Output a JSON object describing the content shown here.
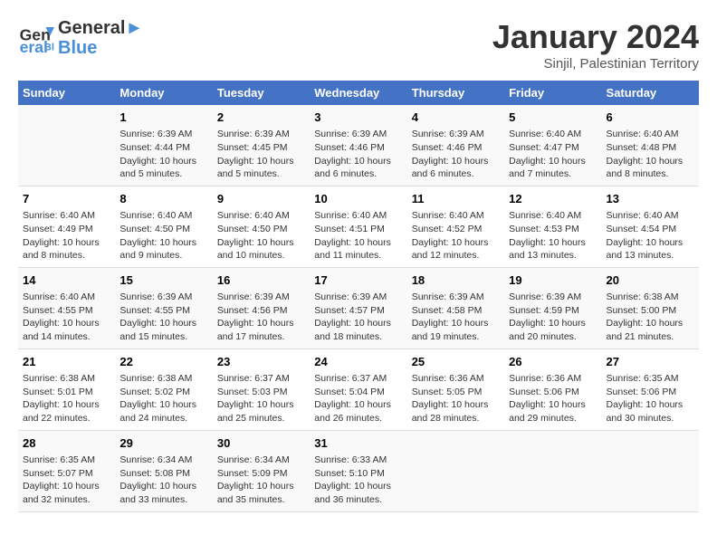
{
  "logo": {
    "line1": "General",
    "line2": "Blue"
  },
  "title": "January 2024",
  "subtitle": "Sinjil, Palestinian Territory",
  "days_header": [
    "Sunday",
    "Monday",
    "Tuesday",
    "Wednesday",
    "Thursday",
    "Friday",
    "Saturday"
  ],
  "weeks": [
    [
      {
        "num": "",
        "text": ""
      },
      {
        "num": "1",
        "text": "Sunrise: 6:39 AM\nSunset: 4:44 PM\nDaylight: 10 hours\nand 5 minutes."
      },
      {
        "num": "2",
        "text": "Sunrise: 6:39 AM\nSunset: 4:45 PM\nDaylight: 10 hours\nand 5 minutes."
      },
      {
        "num": "3",
        "text": "Sunrise: 6:39 AM\nSunset: 4:46 PM\nDaylight: 10 hours\nand 6 minutes."
      },
      {
        "num": "4",
        "text": "Sunrise: 6:39 AM\nSunset: 4:46 PM\nDaylight: 10 hours\nand 6 minutes."
      },
      {
        "num": "5",
        "text": "Sunrise: 6:40 AM\nSunset: 4:47 PM\nDaylight: 10 hours\nand 7 minutes."
      },
      {
        "num": "6",
        "text": "Sunrise: 6:40 AM\nSunset: 4:48 PM\nDaylight: 10 hours\nand 8 minutes."
      }
    ],
    [
      {
        "num": "7",
        "text": "Sunrise: 6:40 AM\nSunset: 4:49 PM\nDaylight: 10 hours\nand 8 minutes."
      },
      {
        "num": "8",
        "text": "Sunrise: 6:40 AM\nSunset: 4:50 PM\nDaylight: 10 hours\nand 9 minutes."
      },
      {
        "num": "9",
        "text": "Sunrise: 6:40 AM\nSunset: 4:50 PM\nDaylight: 10 hours\nand 10 minutes."
      },
      {
        "num": "10",
        "text": "Sunrise: 6:40 AM\nSunset: 4:51 PM\nDaylight: 10 hours\nand 11 minutes."
      },
      {
        "num": "11",
        "text": "Sunrise: 6:40 AM\nSunset: 4:52 PM\nDaylight: 10 hours\nand 12 minutes."
      },
      {
        "num": "12",
        "text": "Sunrise: 6:40 AM\nSunset: 4:53 PM\nDaylight: 10 hours\nand 13 minutes."
      },
      {
        "num": "13",
        "text": "Sunrise: 6:40 AM\nSunset: 4:54 PM\nDaylight: 10 hours\nand 13 minutes."
      }
    ],
    [
      {
        "num": "14",
        "text": "Sunrise: 6:40 AM\nSunset: 4:55 PM\nDaylight: 10 hours\nand 14 minutes."
      },
      {
        "num": "15",
        "text": "Sunrise: 6:39 AM\nSunset: 4:55 PM\nDaylight: 10 hours\nand 15 minutes."
      },
      {
        "num": "16",
        "text": "Sunrise: 6:39 AM\nSunset: 4:56 PM\nDaylight: 10 hours\nand 17 minutes."
      },
      {
        "num": "17",
        "text": "Sunrise: 6:39 AM\nSunset: 4:57 PM\nDaylight: 10 hours\nand 18 minutes."
      },
      {
        "num": "18",
        "text": "Sunrise: 6:39 AM\nSunset: 4:58 PM\nDaylight: 10 hours\nand 19 minutes."
      },
      {
        "num": "19",
        "text": "Sunrise: 6:39 AM\nSunset: 4:59 PM\nDaylight: 10 hours\nand 20 minutes."
      },
      {
        "num": "20",
        "text": "Sunrise: 6:38 AM\nSunset: 5:00 PM\nDaylight: 10 hours\nand 21 minutes."
      }
    ],
    [
      {
        "num": "21",
        "text": "Sunrise: 6:38 AM\nSunset: 5:01 PM\nDaylight: 10 hours\nand 22 minutes."
      },
      {
        "num": "22",
        "text": "Sunrise: 6:38 AM\nSunset: 5:02 PM\nDaylight: 10 hours\nand 24 minutes."
      },
      {
        "num": "23",
        "text": "Sunrise: 6:37 AM\nSunset: 5:03 PM\nDaylight: 10 hours\nand 25 minutes."
      },
      {
        "num": "24",
        "text": "Sunrise: 6:37 AM\nSunset: 5:04 PM\nDaylight: 10 hours\nand 26 minutes."
      },
      {
        "num": "25",
        "text": "Sunrise: 6:36 AM\nSunset: 5:05 PM\nDaylight: 10 hours\nand 28 minutes."
      },
      {
        "num": "26",
        "text": "Sunrise: 6:36 AM\nSunset: 5:06 PM\nDaylight: 10 hours\nand 29 minutes."
      },
      {
        "num": "27",
        "text": "Sunrise: 6:35 AM\nSunset: 5:06 PM\nDaylight: 10 hours\nand 30 minutes."
      }
    ],
    [
      {
        "num": "28",
        "text": "Sunrise: 6:35 AM\nSunset: 5:07 PM\nDaylight: 10 hours\nand 32 minutes."
      },
      {
        "num": "29",
        "text": "Sunrise: 6:34 AM\nSunset: 5:08 PM\nDaylight: 10 hours\nand 33 minutes."
      },
      {
        "num": "30",
        "text": "Sunrise: 6:34 AM\nSunset: 5:09 PM\nDaylight: 10 hours\nand 35 minutes."
      },
      {
        "num": "31",
        "text": "Sunrise: 6:33 AM\nSunset: 5:10 PM\nDaylight: 10 hours\nand 36 minutes."
      },
      {
        "num": "",
        "text": ""
      },
      {
        "num": "",
        "text": ""
      },
      {
        "num": "",
        "text": ""
      }
    ]
  ]
}
